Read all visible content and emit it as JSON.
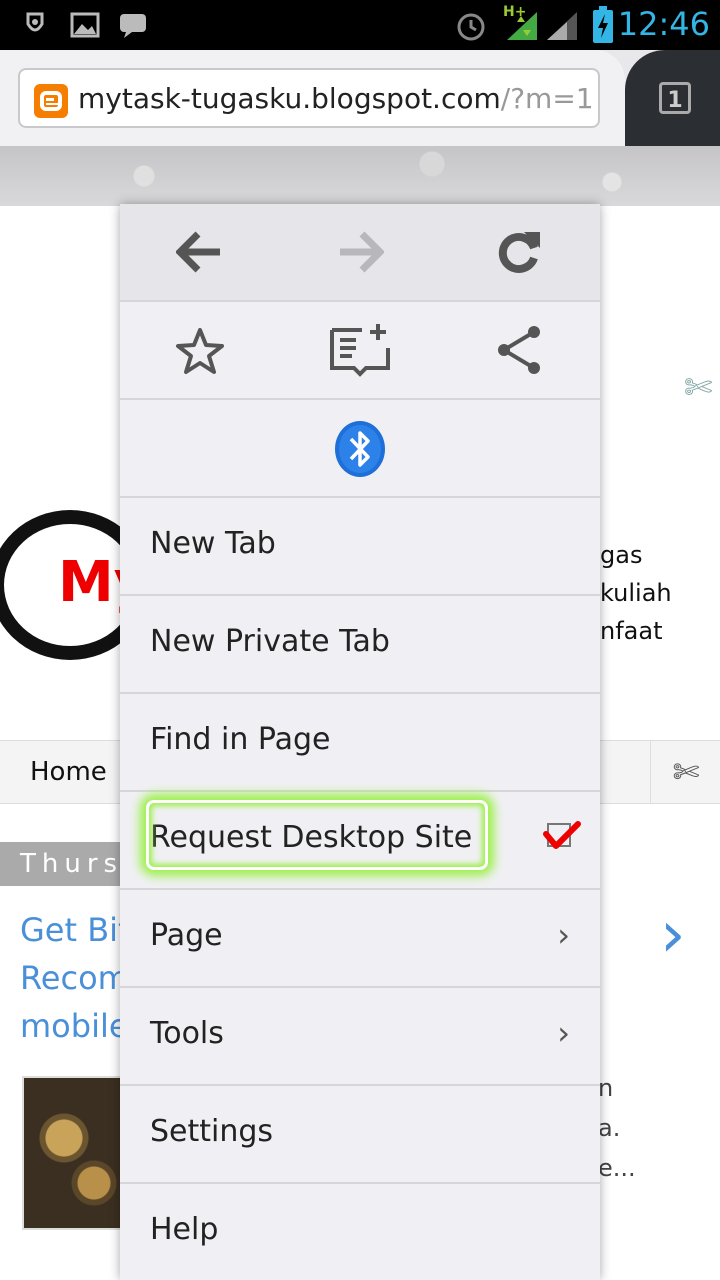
{
  "status_bar": {
    "time": "12:46",
    "network": "H+",
    "icons": [
      "rooted-icon",
      "image-icon",
      "bbm-icon",
      "alarm-icon",
      "data-arrows-icon",
      "signal-icon",
      "battery-charging-icon"
    ]
  },
  "browser": {
    "url_host": "mytask-tugasku.blogspot.com",
    "url_path": "/?m=1",
    "tab_count": "1"
  },
  "page": {
    "logo_text": "My",
    "tagline_1": "gas kuliah",
    "tagline_2": "nfaat",
    "nav_home": "Home",
    "date_label": "Thurs",
    "post_title_1": "Get Bit",
    "post_title_2": "Recom",
    "post_title_3": "mobile",
    "excerpt_1": "n",
    "excerpt_2": "a.",
    "excerpt_3": "e..."
  },
  "menu": {
    "nav_icons": [
      "back-arrow-icon",
      "forward-arrow-icon",
      "reload-icon"
    ],
    "action_icons": [
      "bookmark-star-icon",
      "reading-list-add-icon",
      "share-icon"
    ],
    "bluetooth_icon": "bluetooth-icon",
    "items": [
      {
        "label": "New Tab"
      },
      {
        "label": "New Private Tab"
      },
      {
        "label": "Find in Page"
      },
      {
        "label": "Request Desktop Site",
        "checked": true
      },
      {
        "label": "Page",
        "submenu": true
      },
      {
        "label": "Tools",
        "submenu": true
      },
      {
        "label": "Settings"
      },
      {
        "label": "Help"
      }
    ]
  }
}
